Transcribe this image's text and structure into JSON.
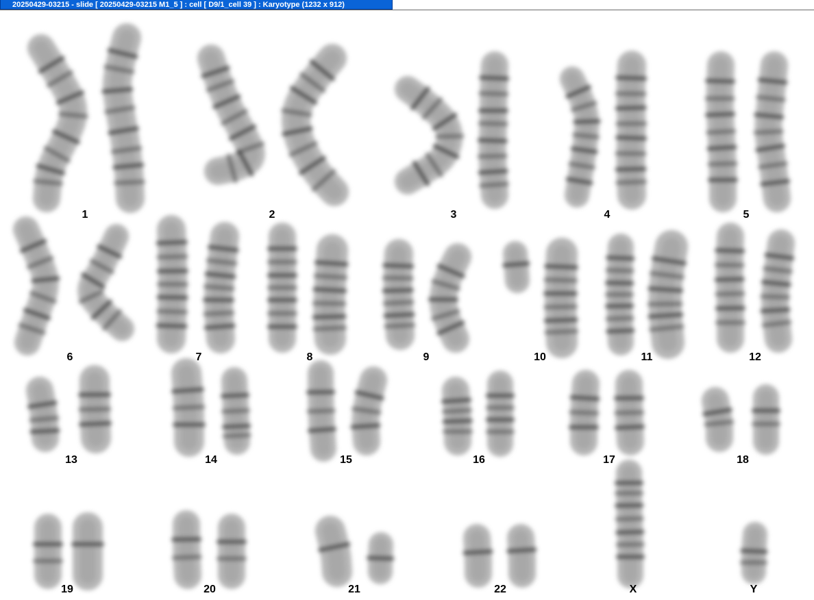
{
  "window": {
    "title": "20250429-03215 - slide [ 20250429-03215 M1_5 ] : cell [ D9/1_cell 39 ] : Karyotype  (1232 x 912)"
  },
  "colors": {
    "titlebar_bg": "#0a64d8",
    "titlebar_text": "#ffffff",
    "background": "#ffffff",
    "chromosome": "#7a7a7a"
  },
  "chromosomes": [
    {
      "label": "1"
    },
    {
      "label": "2"
    },
    {
      "label": "3"
    },
    {
      "label": "4"
    },
    {
      "label": "5"
    },
    {
      "label": "6"
    },
    {
      "label": "7"
    },
    {
      "label": "8"
    },
    {
      "label": "9"
    },
    {
      "label": "10"
    },
    {
      "label": "11"
    },
    {
      "label": "12"
    },
    {
      "label": "13"
    },
    {
      "label": "14"
    },
    {
      "label": "15"
    },
    {
      "label": "16"
    },
    {
      "label": "17"
    },
    {
      "label": "18"
    },
    {
      "label": "19"
    },
    {
      "label": "20"
    },
    {
      "label": "21"
    },
    {
      "label": "22"
    },
    {
      "label": "X"
    },
    {
      "label": "Y"
    }
  ]
}
